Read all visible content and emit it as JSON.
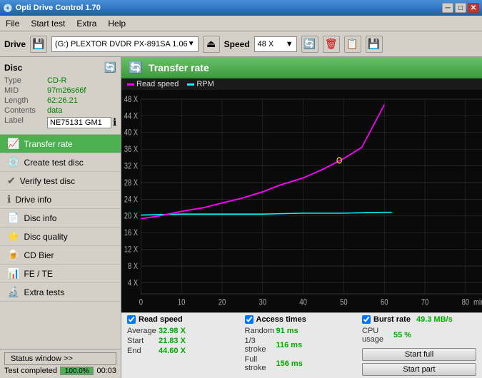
{
  "window": {
    "title": "Opti Drive Control 1.70",
    "controls": {
      "minimize": "─",
      "maximize": "□",
      "close": "✕"
    }
  },
  "menu": {
    "items": [
      "File",
      "Start test",
      "Extra",
      "Help"
    ]
  },
  "drive_bar": {
    "drive_label": "Drive",
    "drive_value": "(G:)  PLEXTOR DVDR  PX-891SA 1.06",
    "speed_label": "Speed",
    "speed_value": "48 X"
  },
  "disc": {
    "title": "Disc",
    "fields": {
      "type_label": "Type",
      "type_value": "CD-R",
      "mid_label": "MID",
      "mid_value": "97m26s66f",
      "length_label": "Length",
      "length_value": "62:26.21",
      "contents_label": "Contents",
      "contents_value": "data",
      "label_label": "Label",
      "label_value": "NE75131 GM1"
    }
  },
  "nav": {
    "items": [
      {
        "id": "transfer-rate",
        "label": "Transfer rate",
        "active": true
      },
      {
        "id": "create-test-disc",
        "label": "Create test disc",
        "active": false
      },
      {
        "id": "verify-test-disc",
        "label": "Verify test disc",
        "active": false
      },
      {
        "id": "drive-info",
        "label": "Drive info",
        "active": false
      },
      {
        "id": "disc-info",
        "label": "Disc info",
        "active": false
      },
      {
        "id": "disc-quality",
        "label": "Disc quality",
        "active": false
      },
      {
        "id": "cd-bier",
        "label": "CD Bier",
        "active": false
      },
      {
        "id": "fe-te",
        "label": "FE / TE",
        "active": false
      },
      {
        "id": "extra-tests",
        "label": "Extra tests",
        "active": false
      }
    ]
  },
  "status": {
    "window_btn": "Status window >>",
    "test_completed": "Test completed",
    "progress_pct": "100.0%",
    "progress_time": "00:03",
    "progress_width": 100
  },
  "chart": {
    "title": "Transfer rate",
    "legend": [
      {
        "id": "read-speed",
        "color": "#ff00ff",
        "label": "Read speed"
      },
      {
        "id": "rpm",
        "color": "#00ffff",
        "label": "RPM"
      }
    ],
    "y_axis": [
      "48 X",
      "44 X",
      "40 X",
      "36 X",
      "32 X",
      "28 X",
      "24 X",
      "20 X",
      "16 X",
      "12 X",
      "8 X",
      "4 X"
    ],
    "x_axis": [
      "0",
      "10",
      "20",
      "30",
      "40",
      "50",
      "60",
      "70",
      "80",
      "min"
    ]
  },
  "stats": {
    "read_speed": {
      "label": "Read speed",
      "average": {
        "name": "Average",
        "value": "32.98 X"
      },
      "start": {
        "name": "Start",
        "value": "21.83 X"
      },
      "end": {
        "name": "End",
        "value": "44.60 X"
      }
    },
    "access_times": {
      "label": "Access times",
      "random": {
        "name": "Random",
        "value": "91 ms"
      },
      "one_third": {
        "name": "1/3 stroke",
        "value": "116 ms"
      },
      "full": {
        "name": "Full stroke",
        "value": "156 ms"
      }
    },
    "burst": {
      "label": "Burst rate",
      "value": "49.3 MB/s",
      "cpu_label": "CPU usage",
      "cpu_value": "55 %"
    },
    "buttons": {
      "start_full": "Start full",
      "start_part": "Start part"
    }
  }
}
